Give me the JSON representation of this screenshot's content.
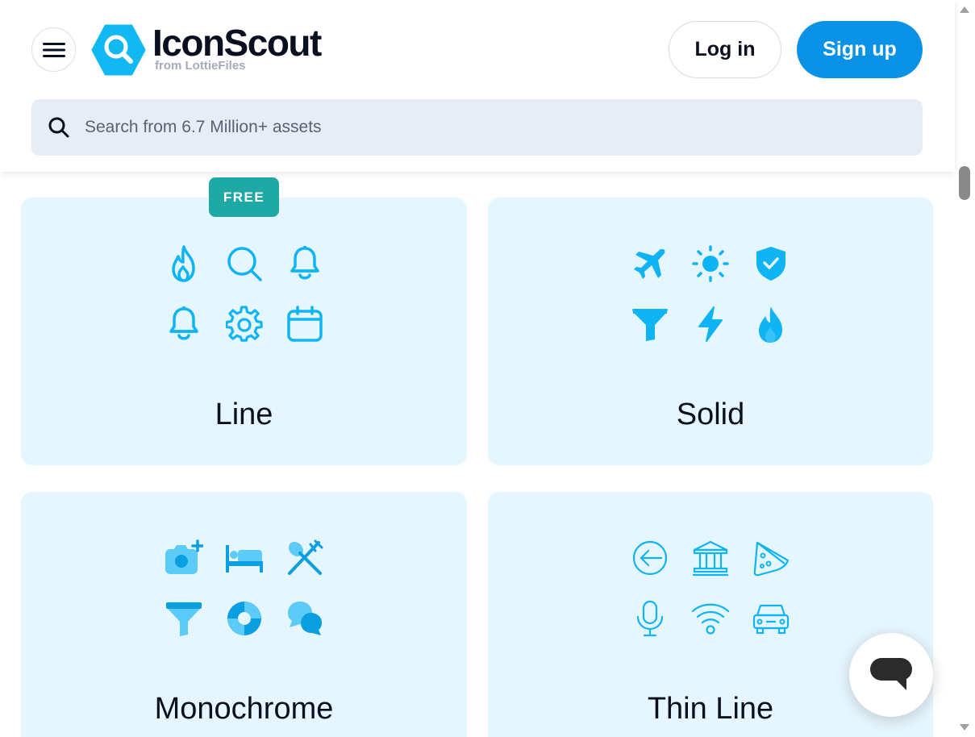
{
  "header": {
    "brand_name": "IconScout",
    "brand_sub": "from LottieFiles",
    "login_label": "Log in",
    "signup_label": "Sign up"
  },
  "search": {
    "placeholder": "Search from 6.7 Million+ assets"
  },
  "cards": [
    {
      "title": "Line",
      "badge": "FREE",
      "icons": [
        "fire-icon",
        "search-icon",
        "bell-icon",
        "bell-icon",
        "gear-icon",
        "calendar-icon"
      ]
    },
    {
      "title": "Solid",
      "icons": [
        "airplane-icon",
        "sun-icon",
        "shield-check-icon",
        "filter-icon",
        "lightning-icon",
        "fire-icon"
      ]
    },
    {
      "title": "Monochrome",
      "icons": [
        "camera-add-icon",
        "bed-icon",
        "utensils-icon",
        "filter-icon",
        "lifebuoy-icon",
        "chat-bubbles-icon"
      ]
    },
    {
      "title": "Thin Line",
      "icons": [
        "arrow-left-circle-icon",
        "bank-icon",
        "pizza-icon",
        "microphone-icon",
        "wifi-icon",
        "car-icon"
      ]
    }
  ],
  "colors": {
    "accent": "#0a93e6",
    "icon": "#0fb4f5",
    "card_bg": "#e6f6fe",
    "badge": "#1fa9a6"
  }
}
